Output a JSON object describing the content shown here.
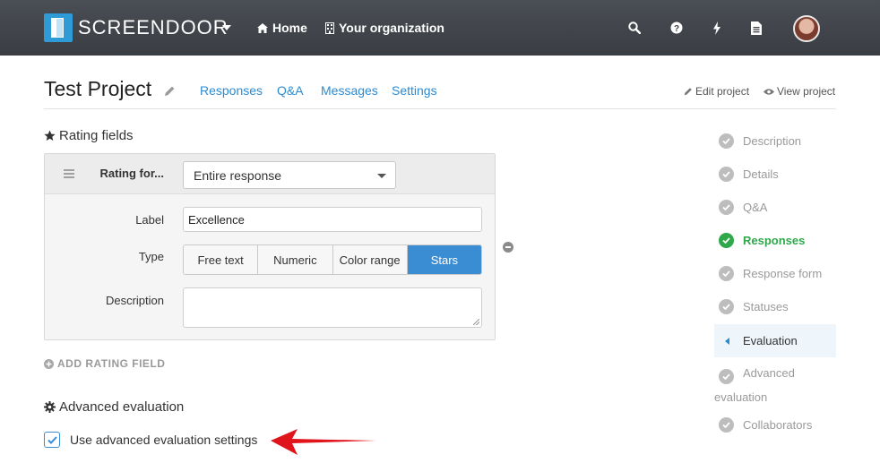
{
  "topbar": {
    "brand": "SCREENDOOR",
    "nav": {
      "home": "Home",
      "organization": "Your organization"
    },
    "icons": [
      "search-icon",
      "help-icon",
      "bolt-icon",
      "document-icon",
      "avatar"
    ]
  },
  "header": {
    "title": "Test Project",
    "tabs": [
      "Responses",
      "Q&A",
      "Messages",
      "Settings"
    ],
    "edit_project": "Edit project",
    "view_project": "View project"
  },
  "rating_fields": {
    "heading": "Rating fields",
    "rating_for_label": "Rating for...",
    "rating_for_value": "Entire response",
    "label_label": "Label",
    "label_value": "Excellence",
    "type_label": "Type",
    "type_options": [
      "Free text",
      "Numeric",
      "Color range",
      "Stars"
    ],
    "type_selected": "Stars",
    "description_label": "Description",
    "description_value": "",
    "add_rating_field": "ADD RATING FIELD"
  },
  "advanced": {
    "heading": "Advanced evaluation",
    "checkbox_label": "Use advanced evaluation settings",
    "checked": true
  },
  "steps": {
    "description": "Description",
    "details": "Details",
    "qa": "Q&A",
    "responses": "Responses",
    "response_form": "Response form",
    "statuses": "Statuses",
    "evaluation": "Evaluation",
    "advanced_evaluation_1": "Advanced",
    "advanced_evaluation_2": "evaluation",
    "collaborators": "Collaborators"
  },
  "colors": {
    "accent": "#3a8dd3",
    "link": "#2b8bd2",
    "success": "#2ea84a",
    "topbar": "#3f4247",
    "arrow": "#e0141b"
  }
}
